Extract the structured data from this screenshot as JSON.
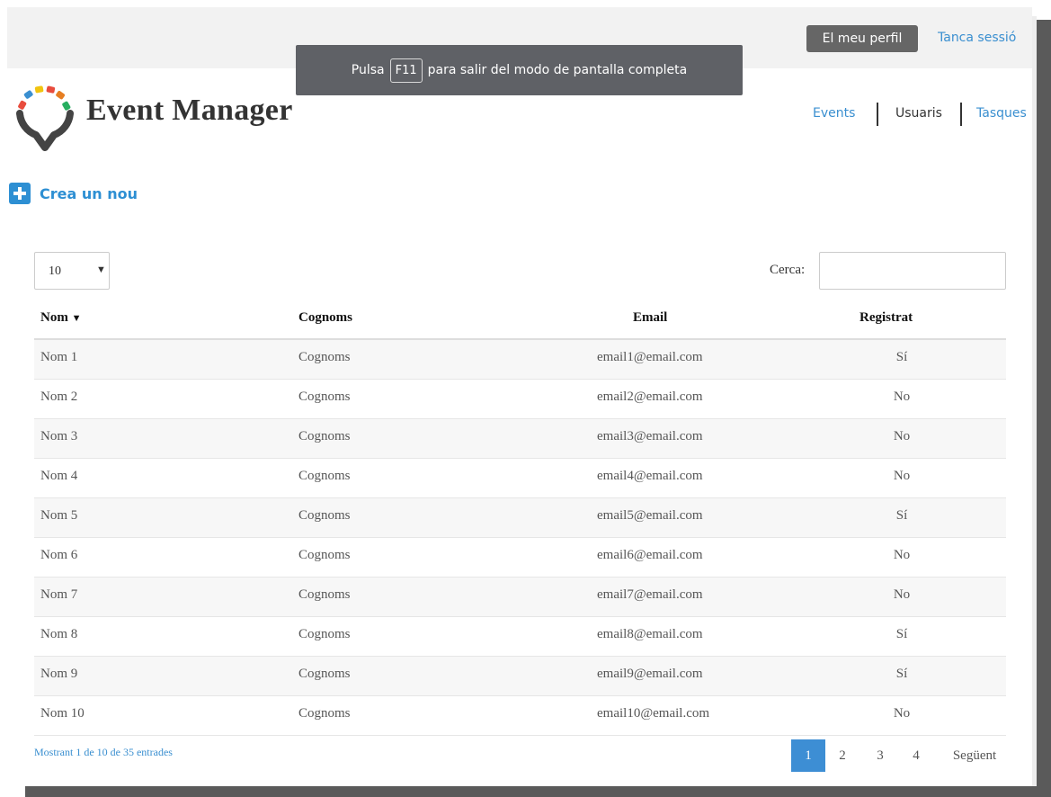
{
  "topbar": {
    "profile_label": "El meu perfil",
    "logout_label": "Tanca sessió"
  },
  "toast": {
    "prefix": "Pulsa",
    "key": "F11",
    "suffix": "para salir del modo de pantalla completa"
  },
  "brand": {
    "name": "Event Manager"
  },
  "nav": {
    "events": "Events",
    "users": "Usuaris",
    "tasks": "Tasques"
  },
  "actions": {
    "create_label": "Crea un nou"
  },
  "table_controls": {
    "page_length": "10",
    "search_label": "Cerca:",
    "search_value": ""
  },
  "table": {
    "headers": [
      "Nom",
      "Cognoms",
      "Email",
      "Registrat"
    ],
    "sort_indicator": "▼",
    "rows": [
      {
        "nom": "Nom 1",
        "cognoms": "Cognoms",
        "email": "email1@email.com",
        "registrat": "Sí"
      },
      {
        "nom": "Nom 2",
        "cognoms": "Cognoms",
        "email": "email2@email.com",
        "registrat": "No"
      },
      {
        "nom": "Nom 3",
        "cognoms": "Cognoms",
        "email": "email3@email.com",
        "registrat": "No"
      },
      {
        "nom": "Nom 4",
        "cognoms": "Cognoms",
        "email": "email4@email.com",
        "registrat": "No"
      },
      {
        "nom": "Nom 5",
        "cognoms": "Cognoms",
        "email": "email5@email.com",
        "registrat": "Sí"
      },
      {
        "nom": "Nom 6",
        "cognoms": "Cognoms",
        "email": "email6@email.com",
        "registrat": "No"
      },
      {
        "nom": "Nom 7",
        "cognoms": "Cognoms",
        "email": "email7@email.com",
        "registrat": "No"
      },
      {
        "nom": "Nom 8",
        "cognoms": "Cognoms",
        "email": "email8@email.com",
        "registrat": "Sí"
      },
      {
        "nom": "Nom 9",
        "cognoms": "Cognoms",
        "email": "email9@email.com",
        "registrat": "Sí"
      },
      {
        "nom": "Nom 10",
        "cognoms": "Cognoms",
        "email": "email10@email.com",
        "registrat": "No"
      }
    ]
  },
  "footer": {
    "info": "Mostrant 1 de 10 de 35 entrades",
    "pages": [
      "1",
      "2",
      "3",
      "4"
    ],
    "next_label": "Següent",
    "current_page": "1"
  },
  "colors": {
    "accent": "#3a8fd0",
    "create_blue": "#2d8fd3",
    "profile_button": "#666666",
    "toast_bg": "#5f6166"
  }
}
